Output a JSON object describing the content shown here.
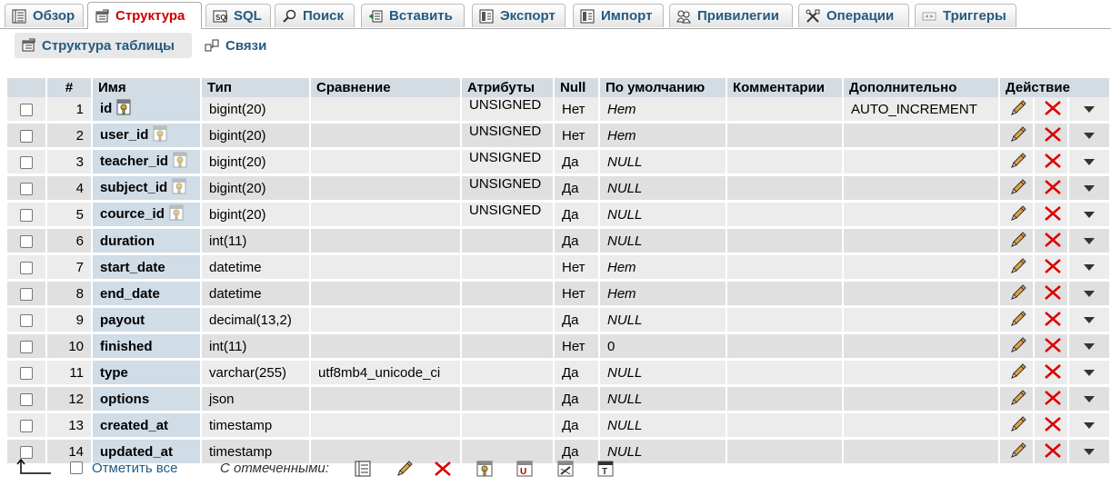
{
  "tabs": [
    {
      "label": "Обзор",
      "icon": "browse-icon"
    },
    {
      "label": "Структура",
      "icon": "structure-icon",
      "active": true
    },
    {
      "label": "SQL",
      "icon": "sql-icon"
    },
    {
      "label": "Поиск",
      "icon": "search-icon"
    },
    {
      "label": "Вставить",
      "icon": "insert-icon"
    },
    {
      "label": "Экспорт",
      "icon": "export-icon"
    },
    {
      "label": "Импорт",
      "icon": "import-icon"
    },
    {
      "label": "Привилегии",
      "icon": "privileges-icon"
    },
    {
      "label": "Операции",
      "icon": "operations-icon"
    },
    {
      "label": "Триггеры",
      "icon": "triggers-icon"
    }
  ],
  "subtabs": [
    {
      "label": "Структура таблицы",
      "icon": "table-structure-icon"
    },
    {
      "label": "Связи",
      "icon": "relations-icon"
    }
  ],
  "columns": [
    "#",
    "Имя",
    "Тип",
    "Сравнение",
    "Атрибуты",
    "Null",
    "По умолчанию",
    "Комментарии",
    "Дополнительно",
    "Действие"
  ],
  "rows": [
    {
      "num": "1",
      "name": "id",
      "key": "primary",
      "type": "bigint(20)",
      "collation": "",
      "attributes": "UNSIGNED",
      "null": "Нет",
      "default": "Нет",
      "default_italic": true,
      "comments": "",
      "extra": "AUTO_INCREMENT"
    },
    {
      "num": "2",
      "name": "user_id",
      "key": "index",
      "type": "bigint(20)",
      "collation": "",
      "attributes": "UNSIGNED",
      "null": "Нет",
      "default": "Нет",
      "default_italic": true,
      "comments": "",
      "extra": ""
    },
    {
      "num": "3",
      "name": "teacher_id",
      "key": "index",
      "type": "bigint(20)",
      "collation": "",
      "attributes": "UNSIGNED",
      "null": "Да",
      "default": "NULL",
      "default_italic": true,
      "comments": "",
      "extra": ""
    },
    {
      "num": "4",
      "name": "subject_id",
      "key": "index",
      "type": "bigint(20)",
      "collation": "",
      "attributes": "UNSIGNED",
      "null": "Да",
      "default": "NULL",
      "default_italic": true,
      "comments": "",
      "extra": ""
    },
    {
      "num": "5",
      "name": "cource_id",
      "key": "index",
      "type": "bigint(20)",
      "collation": "",
      "attributes": "UNSIGNED",
      "null": "Да",
      "default": "NULL",
      "default_italic": true,
      "comments": "",
      "extra": ""
    },
    {
      "num": "6",
      "name": "duration",
      "key": "",
      "type": "int(11)",
      "collation": "",
      "attributes": "",
      "null": "Да",
      "default": "NULL",
      "default_italic": true,
      "comments": "",
      "extra": ""
    },
    {
      "num": "7",
      "name": "start_date",
      "key": "",
      "type": "datetime",
      "collation": "",
      "attributes": "",
      "null": "Нет",
      "default": "Нет",
      "default_italic": true,
      "comments": "",
      "extra": ""
    },
    {
      "num": "8",
      "name": "end_date",
      "key": "",
      "type": "datetime",
      "collation": "",
      "attributes": "",
      "null": "Нет",
      "default": "Нет",
      "default_italic": true,
      "comments": "",
      "extra": ""
    },
    {
      "num": "9",
      "name": "payout",
      "key": "",
      "type": "decimal(13,2)",
      "collation": "",
      "attributes": "",
      "null": "Да",
      "default": "NULL",
      "default_italic": true,
      "comments": "",
      "extra": ""
    },
    {
      "num": "10",
      "name": "finished",
      "key": "",
      "type": "int(11)",
      "collation": "",
      "attributes": "",
      "null": "Нет",
      "default": "0",
      "default_italic": false,
      "comments": "",
      "extra": ""
    },
    {
      "num": "11",
      "name": "type",
      "key": "",
      "type": "varchar(255)",
      "collation": "utf8mb4_unicode_ci",
      "attributes": "",
      "null": "Да",
      "default": "NULL",
      "default_italic": true,
      "comments": "",
      "extra": ""
    },
    {
      "num": "12",
      "name": "options",
      "key": "",
      "type": "json",
      "collation": "",
      "attributes": "",
      "null": "Да",
      "default": "NULL",
      "default_italic": true,
      "comments": "",
      "extra": ""
    },
    {
      "num": "13",
      "name": "created_at",
      "key": "",
      "type": "timestamp",
      "collation": "",
      "attributes": "",
      "null": "Да",
      "default": "NULL",
      "default_italic": true,
      "comments": "",
      "extra": ""
    },
    {
      "num": "14",
      "name": "updated_at",
      "key": "",
      "type": "timestamp",
      "collation": "",
      "attributes": "",
      "null": "Да",
      "default": "NULL",
      "default_italic": true,
      "comments": "",
      "extra": ""
    }
  ],
  "row_actions": [
    "edit-icon",
    "drop-icon",
    "more-dropdown-icon"
  ],
  "footer": {
    "check_all_label": "Отметить все",
    "with_selected_label": "С отмеченными:",
    "actions": [
      "browse-icon",
      "edit-icon",
      "drop-icon",
      "primary-key-icon",
      "unique-icon",
      "index-icon",
      "fulltext-icon"
    ]
  },
  "colors": {
    "accent": "#235a81",
    "active_tab": "#cc0000",
    "header_bg": "#d3dce3",
    "name_col_bg": "#d0dce6",
    "row_a": "#ececec",
    "row_b": "#e0e0e0",
    "drop_red": "#cc0000"
  }
}
